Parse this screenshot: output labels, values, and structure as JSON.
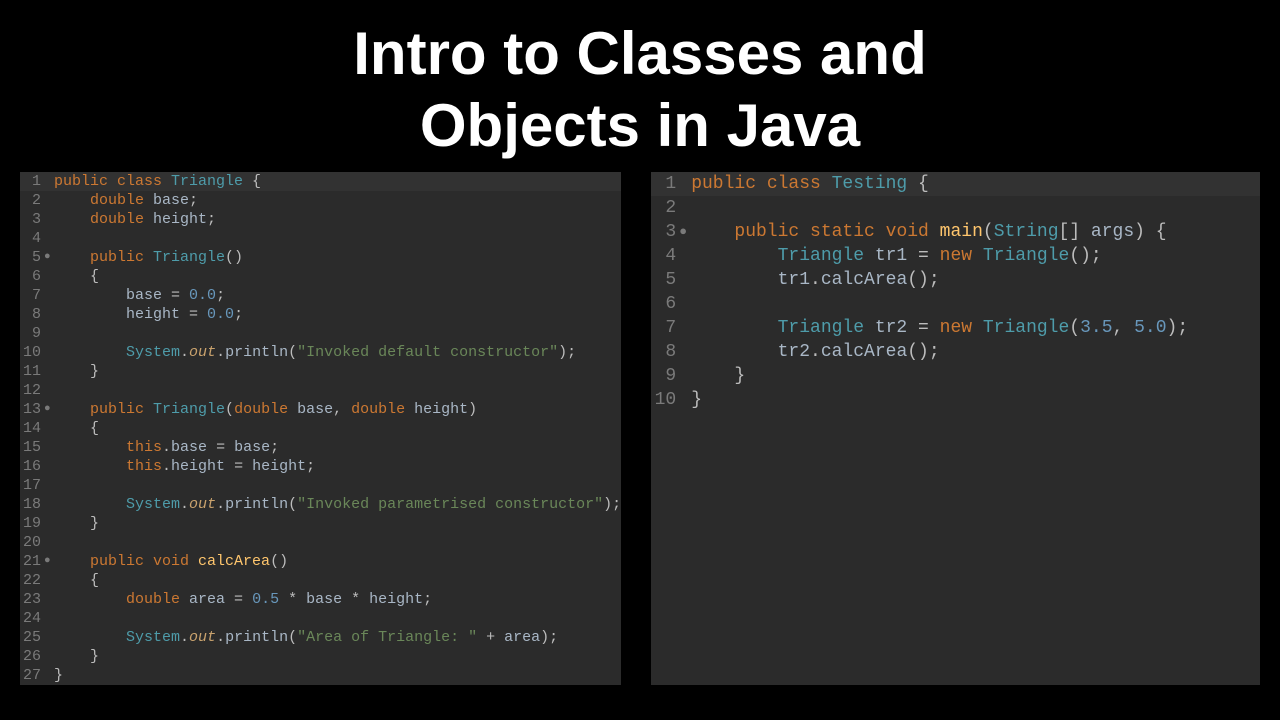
{
  "title_line1": "Intro to Classes and",
  "title_line2": "Objects in Java",
  "left_panel": {
    "lines": [
      {
        "n": 1,
        "mark": "",
        "hl": true,
        "tokens": [
          [
            "kw",
            "public "
          ],
          [
            "kw",
            "class "
          ],
          [
            "type",
            "Triangle"
          ],
          [
            "pun",
            " {"
          ]
        ]
      },
      {
        "n": 2,
        "mark": "",
        "tokens": [
          [
            "plain",
            "    "
          ],
          [
            "kw",
            "double "
          ],
          [
            "var",
            "base"
          ],
          [
            "pun",
            ";"
          ]
        ]
      },
      {
        "n": 3,
        "mark": "",
        "tokens": [
          [
            "plain",
            "    "
          ],
          [
            "kw",
            "double "
          ],
          [
            "var",
            "height"
          ],
          [
            "pun",
            ";"
          ]
        ]
      },
      {
        "n": 4,
        "mark": "",
        "tokens": []
      },
      {
        "n": 5,
        "mark": "●",
        "tokens": [
          [
            "plain",
            "    "
          ],
          [
            "kw",
            "public "
          ],
          [
            "type",
            "Triangle"
          ],
          [
            "pun",
            "()"
          ]
        ]
      },
      {
        "n": 6,
        "mark": "",
        "tokens": [
          [
            "plain",
            "    "
          ],
          [
            "pun",
            "{"
          ]
        ]
      },
      {
        "n": 7,
        "mark": "",
        "tokens": [
          [
            "plain",
            "        "
          ],
          [
            "var",
            "base"
          ],
          [
            "pun",
            " = "
          ],
          [
            "num",
            "0.0"
          ],
          [
            "pun",
            ";"
          ]
        ]
      },
      {
        "n": 8,
        "mark": "",
        "tokens": [
          [
            "plain",
            "        "
          ],
          [
            "var",
            "height"
          ],
          [
            "pun",
            " = "
          ],
          [
            "num",
            "0.0"
          ],
          [
            "pun",
            ";"
          ]
        ]
      },
      {
        "n": 9,
        "mark": "",
        "tokens": []
      },
      {
        "n": 10,
        "mark": "",
        "tokens": [
          [
            "plain",
            "        "
          ],
          [
            "type",
            "System"
          ],
          [
            "pun",
            "."
          ],
          [
            "fld",
            "out"
          ],
          [
            "pun",
            "."
          ],
          [
            "var",
            "println"
          ],
          [
            "pun",
            "("
          ],
          [
            "str",
            "\"Invoked default constructor\""
          ],
          [
            "pun",
            ");"
          ]
        ]
      },
      {
        "n": 11,
        "mark": "",
        "tokens": [
          [
            "plain",
            "    "
          ],
          [
            "pun",
            "}"
          ]
        ]
      },
      {
        "n": 12,
        "mark": "",
        "tokens": []
      },
      {
        "n": 13,
        "mark": "●",
        "tokens": [
          [
            "plain",
            "    "
          ],
          [
            "kw",
            "public "
          ],
          [
            "type",
            "Triangle"
          ],
          [
            "pun",
            "("
          ],
          [
            "kw",
            "double "
          ],
          [
            "var",
            "base"
          ],
          [
            "pun",
            ", "
          ],
          [
            "kw",
            "double "
          ],
          [
            "var",
            "height"
          ],
          [
            "pun",
            ")"
          ]
        ]
      },
      {
        "n": 14,
        "mark": "",
        "tokens": [
          [
            "plain",
            "    "
          ],
          [
            "pun",
            "{"
          ]
        ]
      },
      {
        "n": 15,
        "mark": "",
        "tokens": [
          [
            "plain",
            "        "
          ],
          [
            "kw",
            "this"
          ],
          [
            "pun",
            "."
          ],
          [
            "var",
            "base"
          ],
          [
            "pun",
            " = "
          ],
          [
            "var",
            "base"
          ],
          [
            "pun",
            ";"
          ]
        ]
      },
      {
        "n": 16,
        "mark": "",
        "tokens": [
          [
            "plain",
            "        "
          ],
          [
            "kw",
            "this"
          ],
          [
            "pun",
            "."
          ],
          [
            "var",
            "height"
          ],
          [
            "pun",
            " = "
          ],
          [
            "var",
            "height"
          ],
          [
            "pun",
            ";"
          ]
        ]
      },
      {
        "n": 17,
        "mark": "",
        "tokens": []
      },
      {
        "n": 18,
        "mark": "",
        "tokens": [
          [
            "plain",
            "        "
          ],
          [
            "type",
            "System"
          ],
          [
            "pun",
            "."
          ],
          [
            "fld",
            "out"
          ],
          [
            "pun",
            "."
          ],
          [
            "var",
            "println"
          ],
          [
            "pun",
            "("
          ],
          [
            "str",
            "\"Invoked parametrised constructor\""
          ],
          [
            "pun",
            ");"
          ]
        ]
      },
      {
        "n": 19,
        "mark": "",
        "tokens": [
          [
            "plain",
            "    "
          ],
          [
            "pun",
            "}"
          ]
        ]
      },
      {
        "n": 20,
        "mark": "",
        "tokens": []
      },
      {
        "n": 21,
        "mark": "●",
        "tokens": [
          [
            "plain",
            "    "
          ],
          [
            "kw",
            "public void "
          ],
          [
            "meth",
            "calcArea"
          ],
          [
            "pun",
            "()"
          ]
        ]
      },
      {
        "n": 22,
        "mark": "",
        "tokens": [
          [
            "plain",
            "    "
          ],
          [
            "pun",
            "{"
          ]
        ]
      },
      {
        "n": 23,
        "mark": "",
        "tokens": [
          [
            "plain",
            "        "
          ],
          [
            "kw",
            "double "
          ],
          [
            "var",
            "area"
          ],
          [
            "pun",
            " = "
          ],
          [
            "num",
            "0.5"
          ],
          [
            "pun",
            " * "
          ],
          [
            "var",
            "base"
          ],
          [
            "pun",
            " * "
          ],
          [
            "var",
            "height"
          ],
          [
            "pun",
            ";"
          ]
        ]
      },
      {
        "n": 24,
        "mark": "",
        "tokens": []
      },
      {
        "n": 25,
        "mark": "",
        "tokens": [
          [
            "plain",
            "        "
          ],
          [
            "type",
            "System"
          ],
          [
            "pun",
            "."
          ],
          [
            "fld",
            "out"
          ],
          [
            "pun",
            "."
          ],
          [
            "var",
            "println"
          ],
          [
            "pun",
            "("
          ],
          [
            "str",
            "\"Area of Triangle: \""
          ],
          [
            "pun",
            " + "
          ],
          [
            "var",
            "area"
          ],
          [
            "pun",
            ");"
          ]
        ]
      },
      {
        "n": 26,
        "mark": "",
        "tokens": [
          [
            "plain",
            "    "
          ],
          [
            "pun",
            "}"
          ]
        ]
      },
      {
        "n": 27,
        "mark": "",
        "tokens": [
          [
            "pun",
            "}"
          ]
        ]
      }
    ]
  },
  "right_panel": {
    "lines": [
      {
        "n": 1,
        "mark": "",
        "hl": true,
        "tokens": [
          [
            "kw",
            "public "
          ],
          [
            "kw",
            "class "
          ],
          [
            "type",
            "Testing"
          ],
          [
            "pun",
            " {"
          ]
        ]
      },
      {
        "n": 2,
        "mark": "",
        "tokens": []
      },
      {
        "n": 3,
        "mark": "●",
        "tokens": [
          [
            "plain",
            "    "
          ],
          [
            "kw",
            "public "
          ],
          [
            "kw",
            "static "
          ],
          [
            "kw",
            "void "
          ],
          [
            "meth",
            "main"
          ],
          [
            "pun",
            "("
          ],
          [
            "type",
            "String"
          ],
          [
            "pun",
            "[] "
          ],
          [
            "var",
            "args"
          ],
          [
            "pun",
            ") {"
          ]
        ]
      },
      {
        "n": 4,
        "mark": "",
        "tokens": [
          [
            "plain",
            "        "
          ],
          [
            "type",
            "Triangle "
          ],
          [
            "var",
            "tr1"
          ],
          [
            "pun",
            " = "
          ],
          [
            "kw",
            "new "
          ],
          [
            "type",
            "Triangle"
          ],
          [
            "pun",
            "();"
          ]
        ]
      },
      {
        "n": 5,
        "mark": "",
        "tokens": [
          [
            "plain",
            "        "
          ],
          [
            "var",
            "tr1"
          ],
          [
            "pun",
            "."
          ],
          [
            "var",
            "calcArea"
          ],
          [
            "pun",
            "();"
          ]
        ]
      },
      {
        "n": 6,
        "mark": "",
        "tokens": []
      },
      {
        "n": 7,
        "mark": "",
        "tokens": [
          [
            "plain",
            "        "
          ],
          [
            "type",
            "Triangle "
          ],
          [
            "var",
            "tr2"
          ],
          [
            "pun",
            " = "
          ],
          [
            "kw",
            "new "
          ],
          [
            "type",
            "Triangle"
          ],
          [
            "pun",
            "("
          ],
          [
            "num",
            "3.5"
          ],
          [
            "pun",
            ", "
          ],
          [
            "num",
            "5.0"
          ],
          [
            "pun",
            ");"
          ]
        ]
      },
      {
        "n": 8,
        "mark": "",
        "tokens": [
          [
            "plain",
            "        "
          ],
          [
            "var",
            "tr2"
          ],
          [
            "pun",
            "."
          ],
          [
            "var",
            "calcArea"
          ],
          [
            "pun",
            "();"
          ]
        ]
      },
      {
        "n": 9,
        "mark": "",
        "tokens": [
          [
            "plain",
            "    "
          ],
          [
            "pun",
            "}"
          ]
        ]
      },
      {
        "n": 10,
        "mark": "",
        "tokens": [
          [
            "pun",
            "}"
          ]
        ]
      }
    ]
  }
}
